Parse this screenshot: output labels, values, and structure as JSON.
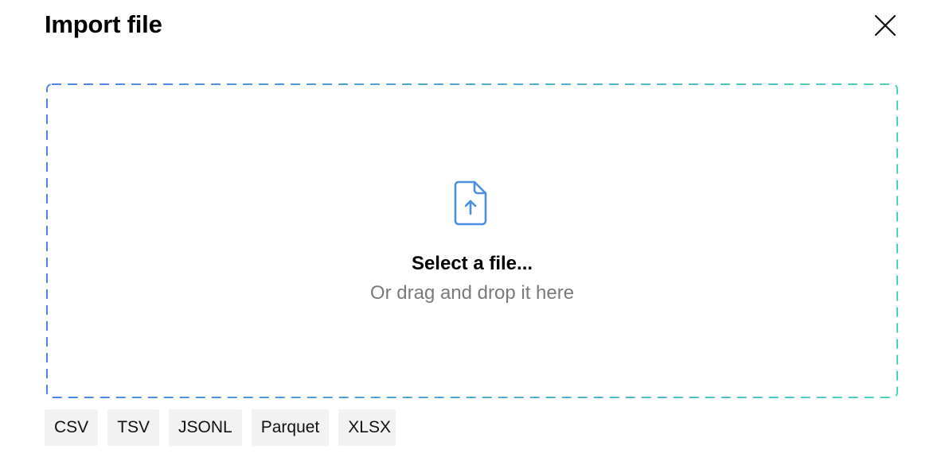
{
  "dialog": {
    "title": "Import file",
    "close_icon": "close-icon"
  },
  "dropzone": {
    "icon": "file-upload-icon",
    "title": "Select a file...",
    "subtitle": "Or drag and drop it here",
    "border_gradient": [
      "#4f83e6",
      "#4fd1c1"
    ],
    "icon_color": "#4a8fe0"
  },
  "formats": [
    "CSV",
    "TSV",
    "JSONL",
    "Parquet",
    "XLSX"
  ]
}
